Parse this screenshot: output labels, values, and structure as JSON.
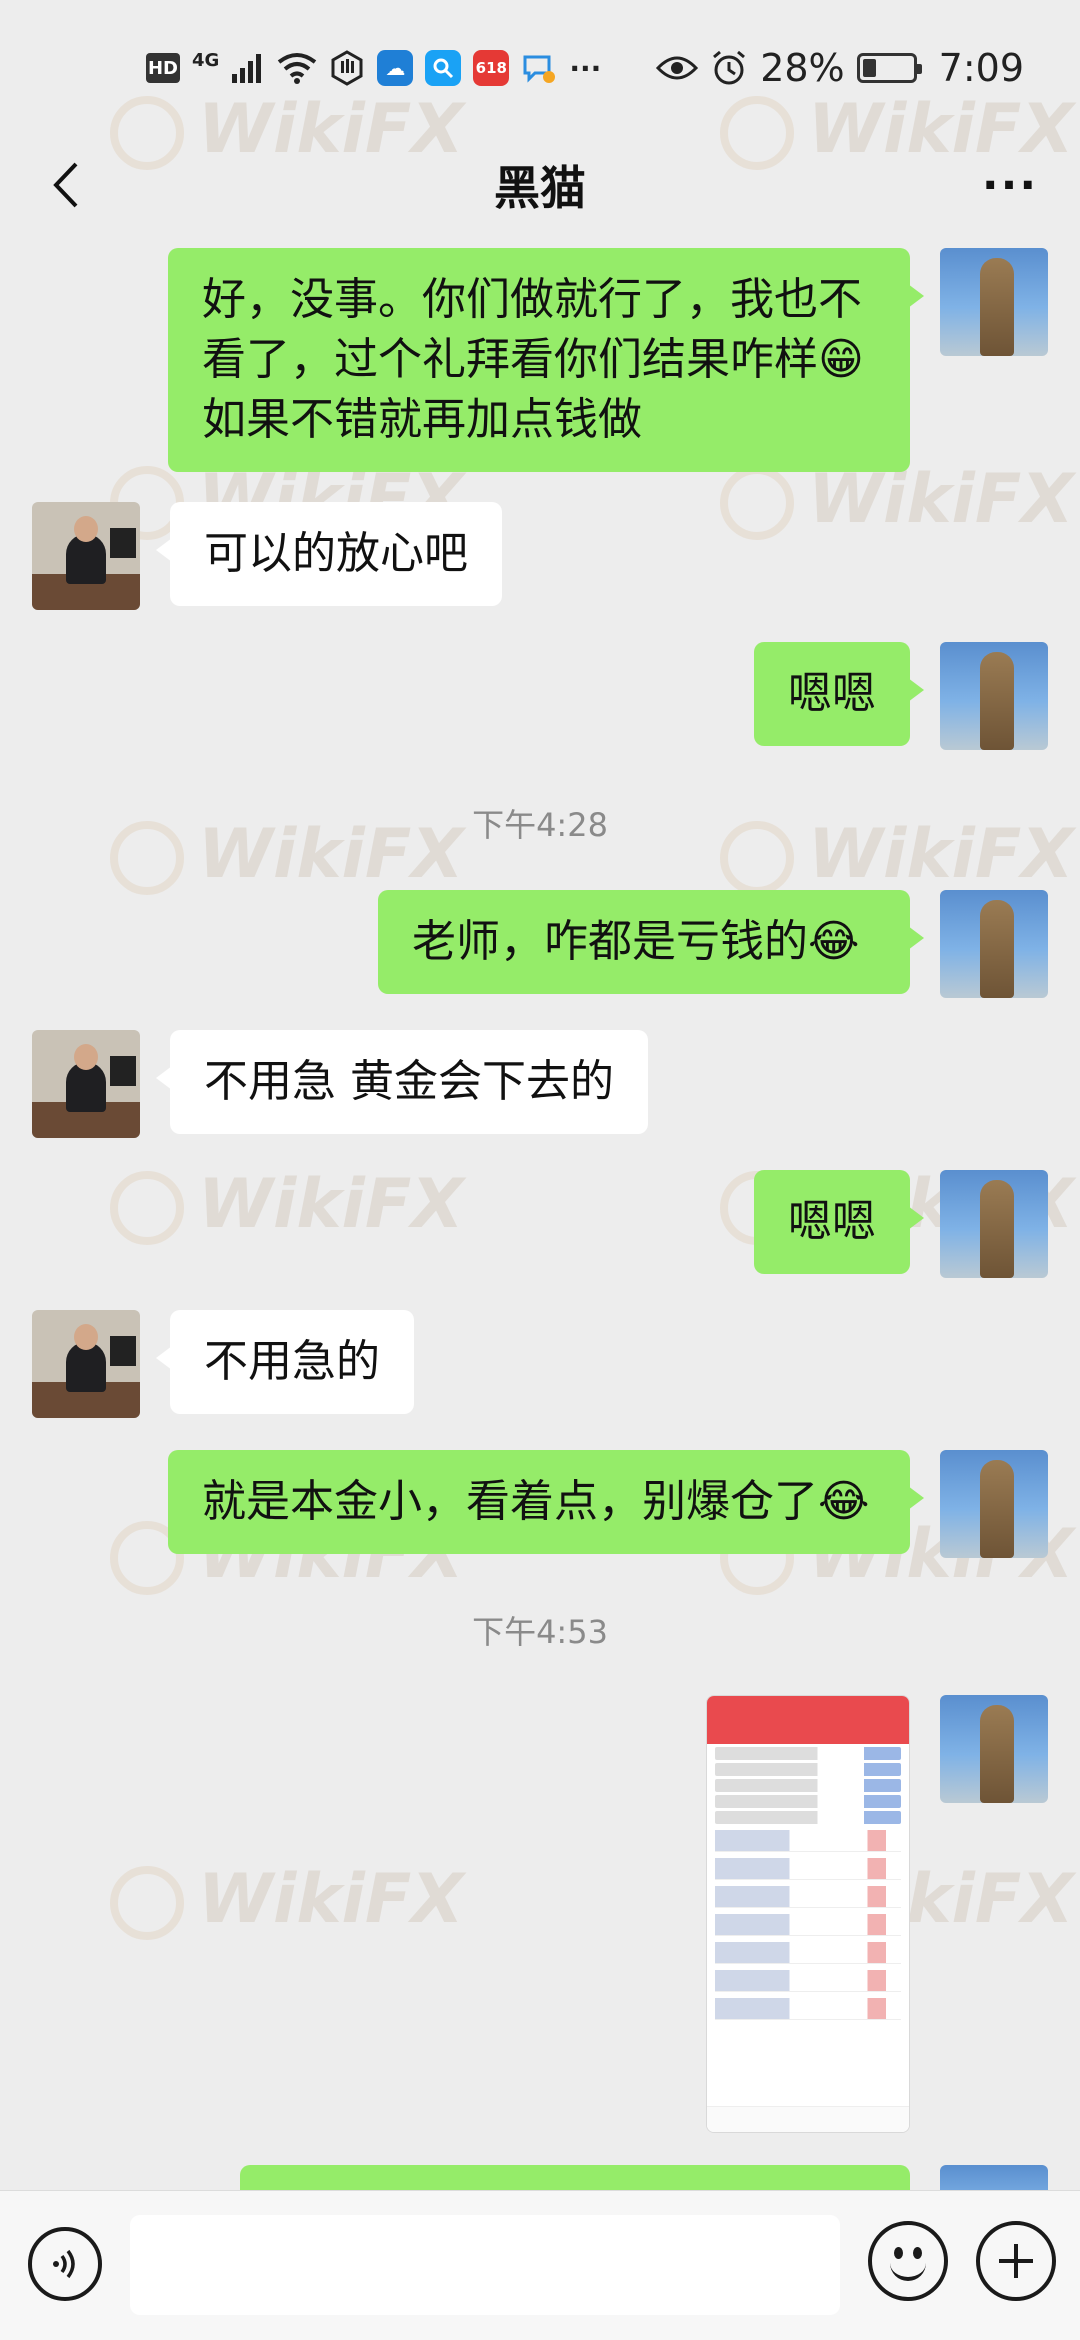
{
  "status_bar": {
    "left_icons": [
      "hd-icon",
      "4g-signal-icon",
      "wifi-icon",
      "hand-icon",
      "weather-app-icon",
      "search-app-icon",
      "618-app-icon",
      "chat-app-icon",
      "more-dots-icon"
    ],
    "hd": "HD",
    "network": "4G",
    "badge_618": "618",
    "more": "···",
    "battery_percent": "28%",
    "battery_level": 0.28,
    "time": "7:09"
  },
  "header": {
    "title": "黑猫",
    "more": "···"
  },
  "watermark": "WikiFX",
  "messages": [
    {
      "from": "me",
      "lines": [
        "好，没事。你们做就行了，我也不",
        "看了，过个礼拜看你们结果咋样😁",
        "如果不错就再加点钱做"
      ]
    },
    {
      "from": "them",
      "text": "可以的放心吧"
    },
    {
      "from": "me",
      "text": "嗯嗯"
    },
    {
      "type": "timestamp",
      "text": "下午4:28"
    },
    {
      "from": "me",
      "text": "老师，咋都是亏钱的😂"
    },
    {
      "from": "them",
      "text": "不用急 黄金会下去的"
    },
    {
      "from": "me",
      "text": "嗯嗯"
    },
    {
      "from": "them",
      "text": "不用急的"
    },
    {
      "from": "me",
      "text": "就是本金小，看着点，别爆仓了😂"
    },
    {
      "type": "timestamp",
      "text": "下午4:53"
    },
    {
      "from": "me",
      "type": "image",
      "description": "trading app screenshot"
    }
  ],
  "input_bar": {
    "placeholder": ""
  },
  "colors": {
    "bg": "#ededed",
    "bubble_me": "#95ec69",
    "bubble_them": "#ffffff",
    "timestamp": "#8a8a8a"
  }
}
